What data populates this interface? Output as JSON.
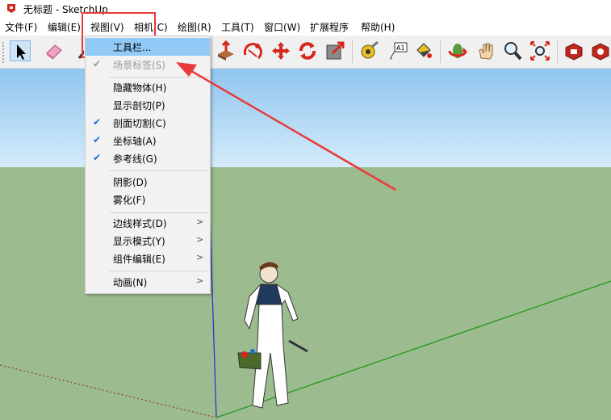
{
  "window": {
    "title": "无标题 - SketchUp",
    "icon": "sketchup-logo-icon"
  },
  "menubar": {
    "items": [
      "文件(F)",
      "编辑(E)",
      "视图(V)",
      "相机(C)",
      "绘图(R)",
      "工具(T)",
      "窗口(W)",
      "扩展程序",
      "帮助(H)"
    ],
    "active_index": 2
  },
  "toolbar": {
    "tools": [
      "select-icon",
      "eraser-icon",
      "line-icon",
      "push-pull-icon",
      "follow-me-icon",
      "move-icon",
      "rotate-icon",
      "scale-icon",
      "tape-measure-icon",
      "text-icon",
      "paint-bucket-icon",
      "orbit-icon",
      "pan-icon",
      "zoom-icon",
      "zoom-extents-icon",
      "3d-warehouse-icon",
      "extension-warehouse-icon"
    ]
  },
  "view_menu": {
    "items": [
      {
        "label": "工具栏...",
        "state": "highlighted",
        "checked": false,
        "submenu": false
      },
      {
        "label": "场景标签(S)",
        "state": "disabled",
        "checked": true,
        "submenu": false
      },
      {
        "label": "隐藏物体(H)",
        "state": "normal",
        "checked": false,
        "submenu": false
      },
      {
        "label": "显示剖切(P)",
        "state": "normal",
        "checked": false,
        "submenu": false
      },
      {
        "label": "剖面切割(C)",
        "state": "normal",
        "checked": true,
        "submenu": false
      },
      {
        "label": "坐标轴(A)",
        "state": "normal",
        "checked": true,
        "submenu": false
      },
      {
        "label": "参考线(G)",
        "state": "normal",
        "checked": true,
        "submenu": false
      },
      {
        "label": "阴影(D)",
        "state": "normal",
        "checked": false,
        "submenu": false
      },
      {
        "label": "雾化(F)",
        "state": "normal",
        "checked": false,
        "submenu": false
      },
      {
        "label": "边线样式(D)",
        "state": "normal",
        "checked": false,
        "submenu": true
      },
      {
        "label": "显示模式(Y)",
        "state": "normal",
        "checked": false,
        "submenu": true
      },
      {
        "label": "组件编辑(E)",
        "state": "normal",
        "checked": false,
        "submenu": true
      },
      {
        "label": "动画(N)",
        "state": "normal",
        "checked": false,
        "submenu": true
      }
    ]
  },
  "glyphs": {
    "check": "✔",
    "submenu_arrow": ">"
  },
  "colors": {
    "highlight": "#91c9f7",
    "annotation": "#ea3b3b",
    "sky": "#8fc5ee",
    "ground": "#9cbb8e"
  }
}
